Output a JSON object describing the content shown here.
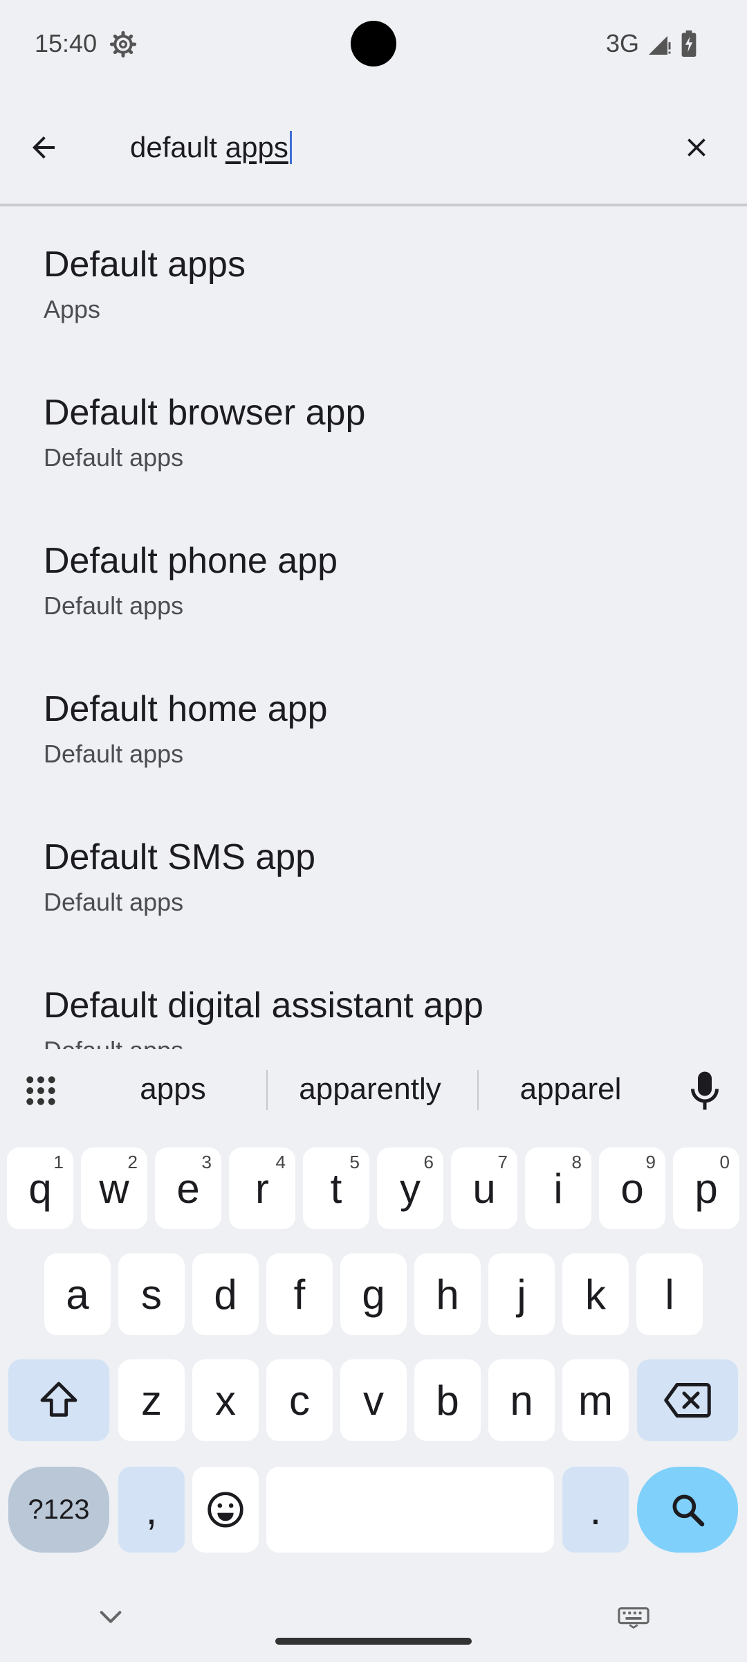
{
  "status_bar": {
    "time": "15:40",
    "network": "3G",
    "icons": [
      "gear-icon",
      "signal-icon",
      "battery-icon"
    ]
  },
  "search": {
    "query_prefix": "default ",
    "query_current_word": "apps"
  },
  "results": [
    {
      "title": "Default apps",
      "subtitle": "Apps"
    },
    {
      "title": "Default browser app",
      "subtitle": "Default apps"
    },
    {
      "title": "Default phone app",
      "subtitle": "Default apps"
    },
    {
      "title": "Default home app",
      "subtitle": "Default apps"
    },
    {
      "title": "Default SMS app",
      "subtitle": "Default apps"
    },
    {
      "title": "Default digital assistant app",
      "subtitle": "Default apps"
    }
  ],
  "keyboard": {
    "suggestions": [
      "apps",
      "apparently",
      "apparel"
    ],
    "row1": [
      "q",
      "w",
      "e",
      "r",
      "t",
      "y",
      "u",
      "i",
      "o",
      "p"
    ],
    "row1_hints": [
      "1",
      "2",
      "3",
      "4",
      "5",
      "6",
      "7",
      "8",
      "9",
      "0"
    ],
    "row2": [
      "a",
      "s",
      "d",
      "f",
      "g",
      "h",
      "j",
      "k",
      "l"
    ],
    "row3": [
      "z",
      "x",
      "c",
      "v",
      "b",
      "n",
      "m"
    ],
    "symbols_label": "?123",
    "comma": ",",
    "period": ".",
    "colors": {
      "accent": "#7fd0fb",
      "modifier": "#d3e3f5",
      "key": "#ffffff"
    }
  }
}
